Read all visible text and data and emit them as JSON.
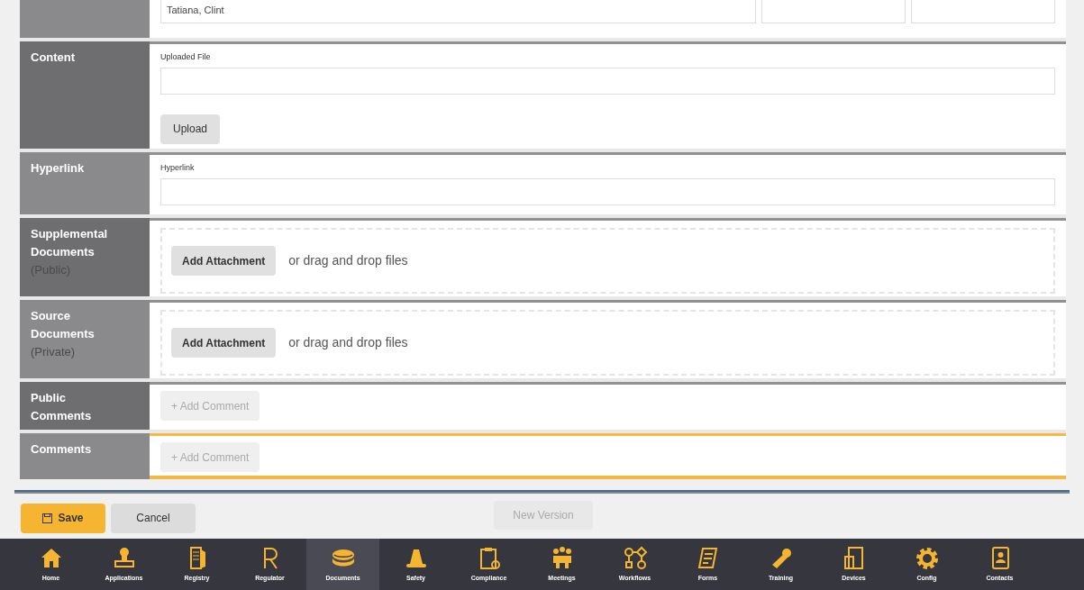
{
  "form_rows": [
    {
      "kind": "text_inputs",
      "label": "",
      "fields": [
        {
          "kind": "name",
          "value": "Tatiana, Clint"
        },
        {
          "kind": "blank"
        },
        {
          "kind": "blank"
        }
      ]
    },
    {
      "kind": "upload",
      "label": "Content",
      "field_label": "Uploaded File",
      "button": "Upload"
    },
    {
      "kind": "hyperlink",
      "label": "Hyperlink",
      "field_label": "Hyperlink"
    },
    {
      "kind": "attachments",
      "label": "Supplemental Documents",
      "sublabel": "(Public)",
      "button": "Add Attachment",
      "hint": "or drag and drop files"
    },
    {
      "kind": "attachments",
      "label": "Source Documents",
      "sublabel": "(Private)",
      "button": "Add Attachment",
      "hint": "or drag and drop files"
    },
    {
      "kind": "comments",
      "label": "Public Comments",
      "button": "+ Add Comment",
      "disabled": true
    },
    {
      "kind": "comments",
      "label": "Comments",
      "button": "+ Add Comment",
      "disabled": true
    }
  ],
  "actions": {
    "save": "Save",
    "cancel": "Cancel",
    "new_version": {
      "label": "New Version",
      "disabled": true
    }
  },
  "nav": [
    {
      "label": "Home",
      "selected": false
    },
    {
      "label": "Applications",
      "selected": false
    },
    {
      "label": "Registry",
      "selected": false
    },
    {
      "label": "Regulator",
      "selected": false
    },
    {
      "label": "Documents",
      "selected": true
    },
    {
      "label": "Safety",
      "selected": false
    },
    {
      "label": "Compliance",
      "selected": false
    },
    {
      "label": "Meetings",
      "selected": false
    },
    {
      "label": "Workflows",
      "selected": false
    },
    {
      "label": "Forms",
      "selected": false
    },
    {
      "label": "Training",
      "selected": false
    },
    {
      "label": "Devices",
      "selected": false
    },
    {
      "label": "Config",
      "selected": false
    },
    {
      "label": "Contacts",
      "selected": false
    }
  ]
}
